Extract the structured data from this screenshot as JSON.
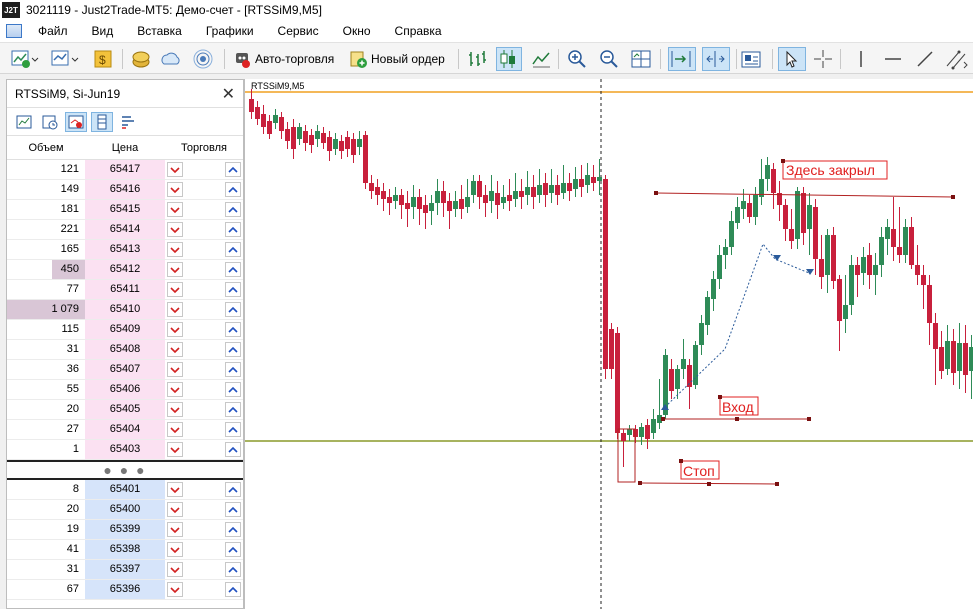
{
  "window": {
    "logo": "J2T",
    "title": "3021119 - Just2Trade-MT5: Демо-счет - [RTSSiM9,M5]"
  },
  "menu": [
    "Файл",
    "Вид",
    "Вставка",
    "Графики",
    "Сервис",
    "Окно",
    "Справка"
  ],
  "toolbar": {
    "auto_trading": "Авто-торговля",
    "new_order": "Новый ордер"
  },
  "dom": {
    "title": "RTSSiM9, Si-Jun19",
    "columns": {
      "volume": "Объем",
      "price": "Цена",
      "trade": "Торговля"
    },
    "asks": [
      {
        "volume": "121",
        "price": "65417",
        "level": 0.0
      },
      {
        "volume": "149",
        "price": "65416",
        "level": 0.0
      },
      {
        "volume": "181",
        "price": "65415",
        "level": 0.0
      },
      {
        "volume": "221",
        "price": "65414",
        "level": 0.0
      },
      {
        "volume": "165",
        "price": "65413",
        "level": 0.0
      },
      {
        "volume": "450",
        "price": "65412",
        "level": 0.42
      },
      {
        "volume": "77",
        "price": "65411",
        "level": 0.0
      },
      {
        "volume": "1 079",
        "price": "65410",
        "level": 1.0
      },
      {
        "volume": "115",
        "price": "65409",
        "level": 0.0
      },
      {
        "volume": "31",
        "price": "65408",
        "level": 0.0
      },
      {
        "volume": "36",
        "price": "65407",
        "level": 0.0
      },
      {
        "volume": "55",
        "price": "65406",
        "level": 0.0
      },
      {
        "volume": "20",
        "price": "65405",
        "level": 0.0
      },
      {
        "volume": "27",
        "price": "65404",
        "level": 0.0
      },
      {
        "volume": "1",
        "price": "65403",
        "level": 0.0
      }
    ],
    "bids": [
      {
        "volume": "8",
        "price": "65401"
      },
      {
        "volume": "20",
        "price": "65400"
      },
      {
        "volume": "19",
        "price": "65399"
      },
      {
        "volume": "41",
        "price": "65398"
      },
      {
        "volume": "31",
        "price": "65397"
      },
      {
        "volume": "67",
        "price": "65396"
      }
    ]
  },
  "chart": {
    "symbol_label": "RTSSiM9,M5",
    "annotations": {
      "close": "Здесь закрыл",
      "entry": "Вход",
      "stop": "Стоп"
    },
    "colors": {
      "bull": "#2e8b57",
      "bear": "#c8203c",
      "level_orange": "#f0a020",
      "level_olive": "#8a9a2a",
      "annotation": "#e02020"
    }
  }
}
